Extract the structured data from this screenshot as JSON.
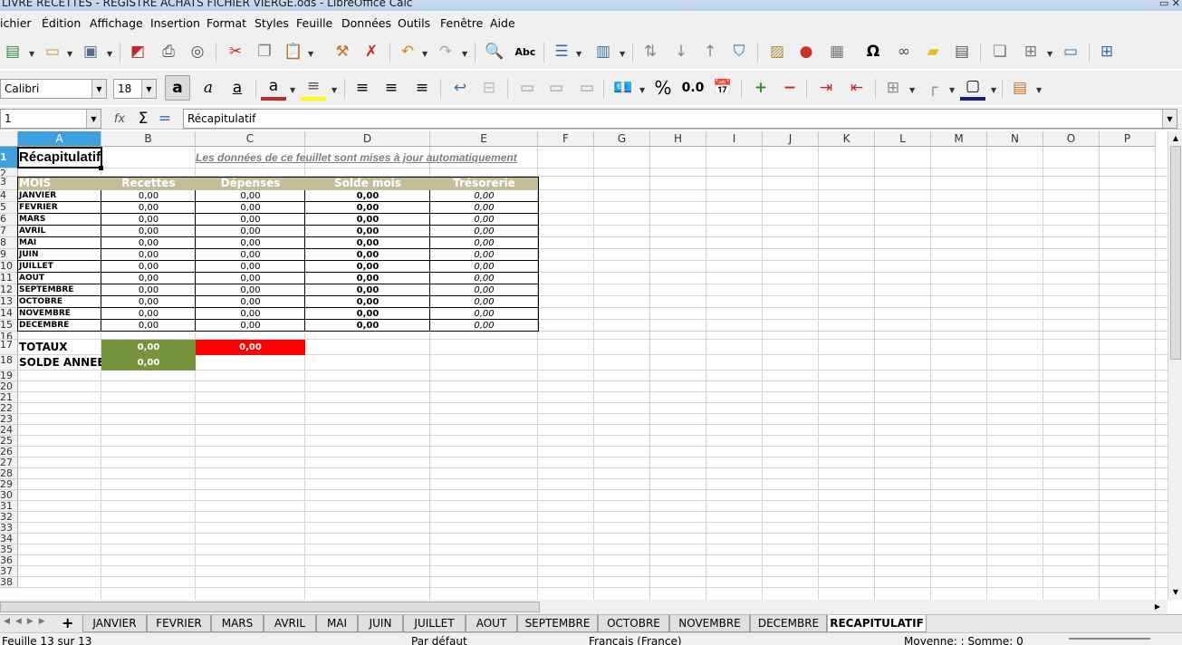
{
  "window": {
    "title": "LIVRE RECETTES - REGISTRE ACHATS FICHIER VIERGE.ods - LibreOffice Calc"
  },
  "menu": [
    "ichier",
    "Édition",
    "Affichage",
    "Insertion",
    "Format",
    "Styles",
    "Feuille",
    "Données",
    "Outils",
    "Fenêtre",
    "Aide"
  ],
  "toolbar": {
    "font_name": "Calibri",
    "font_size": "18",
    "percent_label": "%",
    "decimal_label": "0.0",
    "omega_label": "Ω"
  },
  "formula_bar": {
    "cell_ref": "1",
    "content": "Récapitulatif"
  },
  "grid": {
    "columns": [
      "A",
      "B",
      "C",
      "D",
      "E",
      "F",
      "G",
      "H",
      "I",
      "J",
      "K",
      "L",
      "M",
      "N",
      "O",
      "P"
    ],
    "rows": [
      "1",
      "2",
      "3",
      "4",
      "5",
      "6",
      "7",
      "8",
      "9",
      "10",
      "11",
      "12",
      "13",
      "14",
      "15",
      "16",
      "17",
      "18",
      "19",
      "20",
      "21",
      "22",
      "23",
      "24",
      "25",
      "26",
      "27",
      "28",
      "29",
      "30",
      "31",
      "32",
      "33",
      "34",
      "35",
      "36",
      "37",
      "38"
    ],
    "title": "Récapitulatif",
    "note": "Les données de ce feuillet sont mises à jour automatiquement",
    "headers": [
      "MOIS",
      "Recettes",
      "Dépenses",
      "Solde mois",
      "Trésorerie"
    ],
    "months": [
      {
        "mois": "JANVIER",
        "recettes": "0,00",
        "depenses": "0,00",
        "solde": "0,00",
        "tresorerie": "0,00"
      },
      {
        "mois": "FEVRIER",
        "recettes": "0,00",
        "depenses": "0,00",
        "solde": "0,00",
        "tresorerie": "0,00"
      },
      {
        "mois": "MARS",
        "recettes": "0,00",
        "depenses": "0,00",
        "solde": "0,00",
        "tresorerie": "0,00"
      },
      {
        "mois": "AVRIL",
        "recettes": "0,00",
        "depenses": "0,00",
        "solde": "0,00",
        "tresorerie": "0,00"
      },
      {
        "mois": "MAI",
        "recettes": "0,00",
        "depenses": "0,00",
        "solde": "0,00",
        "tresorerie": "0,00"
      },
      {
        "mois": "JUIN",
        "recettes": "0,00",
        "depenses": "0,00",
        "solde": "0,00",
        "tresorerie": "0,00"
      },
      {
        "mois": "JUILLET",
        "recettes": "0,00",
        "depenses": "0,00",
        "solde": "0,00",
        "tresorerie": "0,00"
      },
      {
        "mois": "AOUT",
        "recettes": "0,00",
        "depenses": "0,00",
        "solde": "0,00",
        "tresorerie": "0,00"
      },
      {
        "mois": "SEPTEMBRE",
        "recettes": "0,00",
        "depenses": "0,00",
        "solde": "0,00",
        "tresorerie": "0,00"
      },
      {
        "mois": "OCTOBRE",
        "recettes": "0,00",
        "depenses": "0,00",
        "solde": "0,00",
        "tresorerie": "0,00"
      },
      {
        "mois": "NOVEMBRE",
        "recettes": "0,00",
        "depenses": "0,00",
        "solde": "0,00",
        "tresorerie": "0,00"
      },
      {
        "mois": "DECEMBRE",
        "recettes": "0,00",
        "depenses": "0,00",
        "solde": "0,00",
        "tresorerie": "0,00"
      }
    ],
    "totaux": {
      "label": "TOTAUX",
      "recettes": "0,00",
      "depenses": "0,00"
    },
    "solde_annee": {
      "label": "SOLDE ANNEE",
      "value": "0,00"
    }
  },
  "sheet_tabs": [
    "JANVIER",
    "FEVRIER",
    "MARS",
    "AVRIL",
    "MAI",
    "JUIN",
    "JUILLET",
    "AOUT",
    "SEPTEMBRE",
    "OCTOBRE",
    "NOVEMBRE",
    "DECEMBRE",
    "RECAPITULATIF"
  ],
  "active_tab": "RECAPITULATIF",
  "add_sheet_label": "+",
  "status": {
    "sheet": "Feuille 13 sur 13",
    "style": "Par défaut",
    "language": "Français (France)",
    "stats": "Moyenne: ; Somme: 0"
  },
  "colors": {
    "header_fill": "#c4bd97",
    "green_fill": "#77933c",
    "red_fill": "#ff0000",
    "selection": "#3da0e0"
  }
}
